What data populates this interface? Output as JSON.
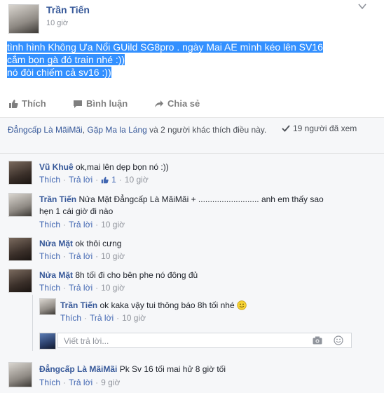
{
  "post": {
    "author": "Trần Tiến",
    "time": "10 giờ",
    "text_lines": [
      "tình hình Không Ưa Nổi GUild SG8pro . ngày Mai AE mình kéo lên SV16",
      "cắm bọn gà đó train nhé :))",
      "nó đòi chiếm cả sv16 :))"
    ]
  },
  "actions": {
    "like": "Thích",
    "comment": "Bình luận",
    "share": "Chia sẻ"
  },
  "likers": {
    "name1": "Đẳngcấp Là MãiMãi",
    "name2": "Gặp Ma la Láng",
    "rest": "và 2 người khác thích điều này."
  },
  "views": "19 người đã xem",
  "comments": [
    {
      "name": "Vũ Khuê",
      "text": "ok,mai lên dẹp bọn nó :))",
      "like": "Thích",
      "reply": "Trả lời",
      "likes": "1",
      "time": "10 giờ"
    },
    {
      "name": "Trần Tiến",
      "text1": "Nửa Mặt Đẳngcấp Là MãiMãi + .......................... anh em thấy sao",
      "text2": "hẹn 1 cái giờ đi nào",
      "like": "Thích",
      "reply": "Trả lời",
      "time": "10 giờ"
    },
    {
      "name": "Nửa Mặt",
      "text": "ok thôi cưng",
      "like": "Thích",
      "reply": "Trả lời",
      "time": "10 giờ"
    },
    {
      "name": "Nửa Mặt",
      "text": "8h tối đi cho bên phe nó đông đủ",
      "like": "Thích",
      "reply": "Trả lời",
      "time": "10 giờ"
    },
    {
      "name": "Trần Tiến",
      "text": "ok kaka vậy tui thông báo 8h tối nhé",
      "like": "Thích",
      "reply": "Trả lời",
      "time": "10 giờ"
    },
    {
      "name": "Đẳngcấp Là MãiMãi",
      "text": "Pk Sv 16 tối mai hử 8 giờ tối",
      "like": "Thích",
      "reply": "Trả lời",
      "time": "9 giờ"
    }
  ],
  "reply_placeholder": "Viết trả lời...",
  "meta_sep": "·",
  "colors": {
    "highlight": "#3390ff",
    "link": "#365899",
    "accent": "#4267b2"
  }
}
